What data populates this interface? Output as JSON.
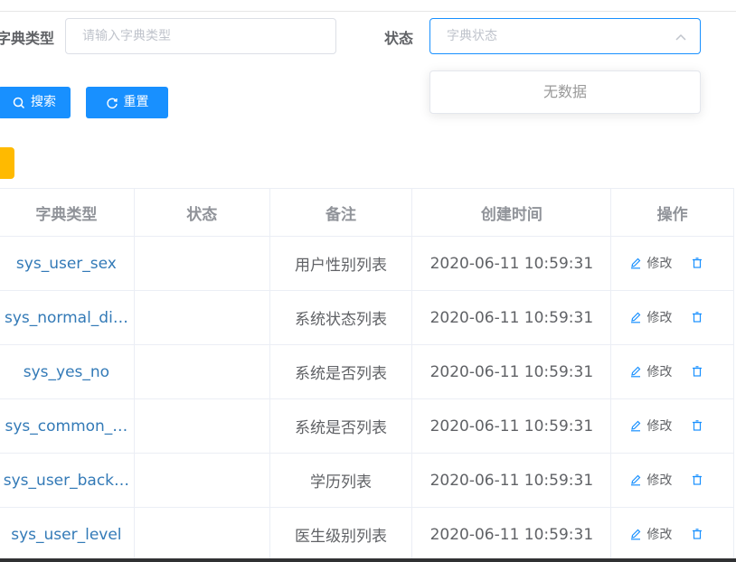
{
  "search": {
    "dict_type_label": "字典类型",
    "dict_type_placeholder": "请输入字典类型",
    "status_label": "状态",
    "status_placeholder": "字典状态",
    "status_dropdown_empty": "无数据",
    "search_button": "搜索",
    "reset_button": "重置"
  },
  "colors": {
    "primary": "#1890ff",
    "warning": "#ffba00",
    "link": "#337ab7"
  },
  "table": {
    "headers": [
      "字典类型",
      "状态",
      "备注",
      "创建时间",
      "操作"
    ],
    "edit_label": "修改",
    "rows": [
      {
        "dict_type": "sys_user_sex",
        "status": "",
        "remark": "用户性别列表",
        "created": "2020-06-11 10:59:31"
      },
      {
        "dict_type": "sys_normal_di…",
        "status": "",
        "remark": "系统状态列表",
        "created": "2020-06-11 10:59:31"
      },
      {
        "dict_type": "sys_yes_no",
        "status": "",
        "remark": "系统是否列表",
        "created": "2020-06-11 10:59:31"
      },
      {
        "dict_type": "sys_common_…",
        "status": "",
        "remark": "系统是否列表",
        "created": "2020-06-11 10:59:31"
      },
      {
        "dict_type": "sys_user_back…",
        "status": "",
        "remark": "学历列表",
        "created": "2020-06-11 10:59:31"
      },
      {
        "dict_type": "sys_user_level",
        "status": "",
        "remark": "医生级别列表",
        "created": "2020-06-11 10:59:31"
      }
    ]
  }
}
